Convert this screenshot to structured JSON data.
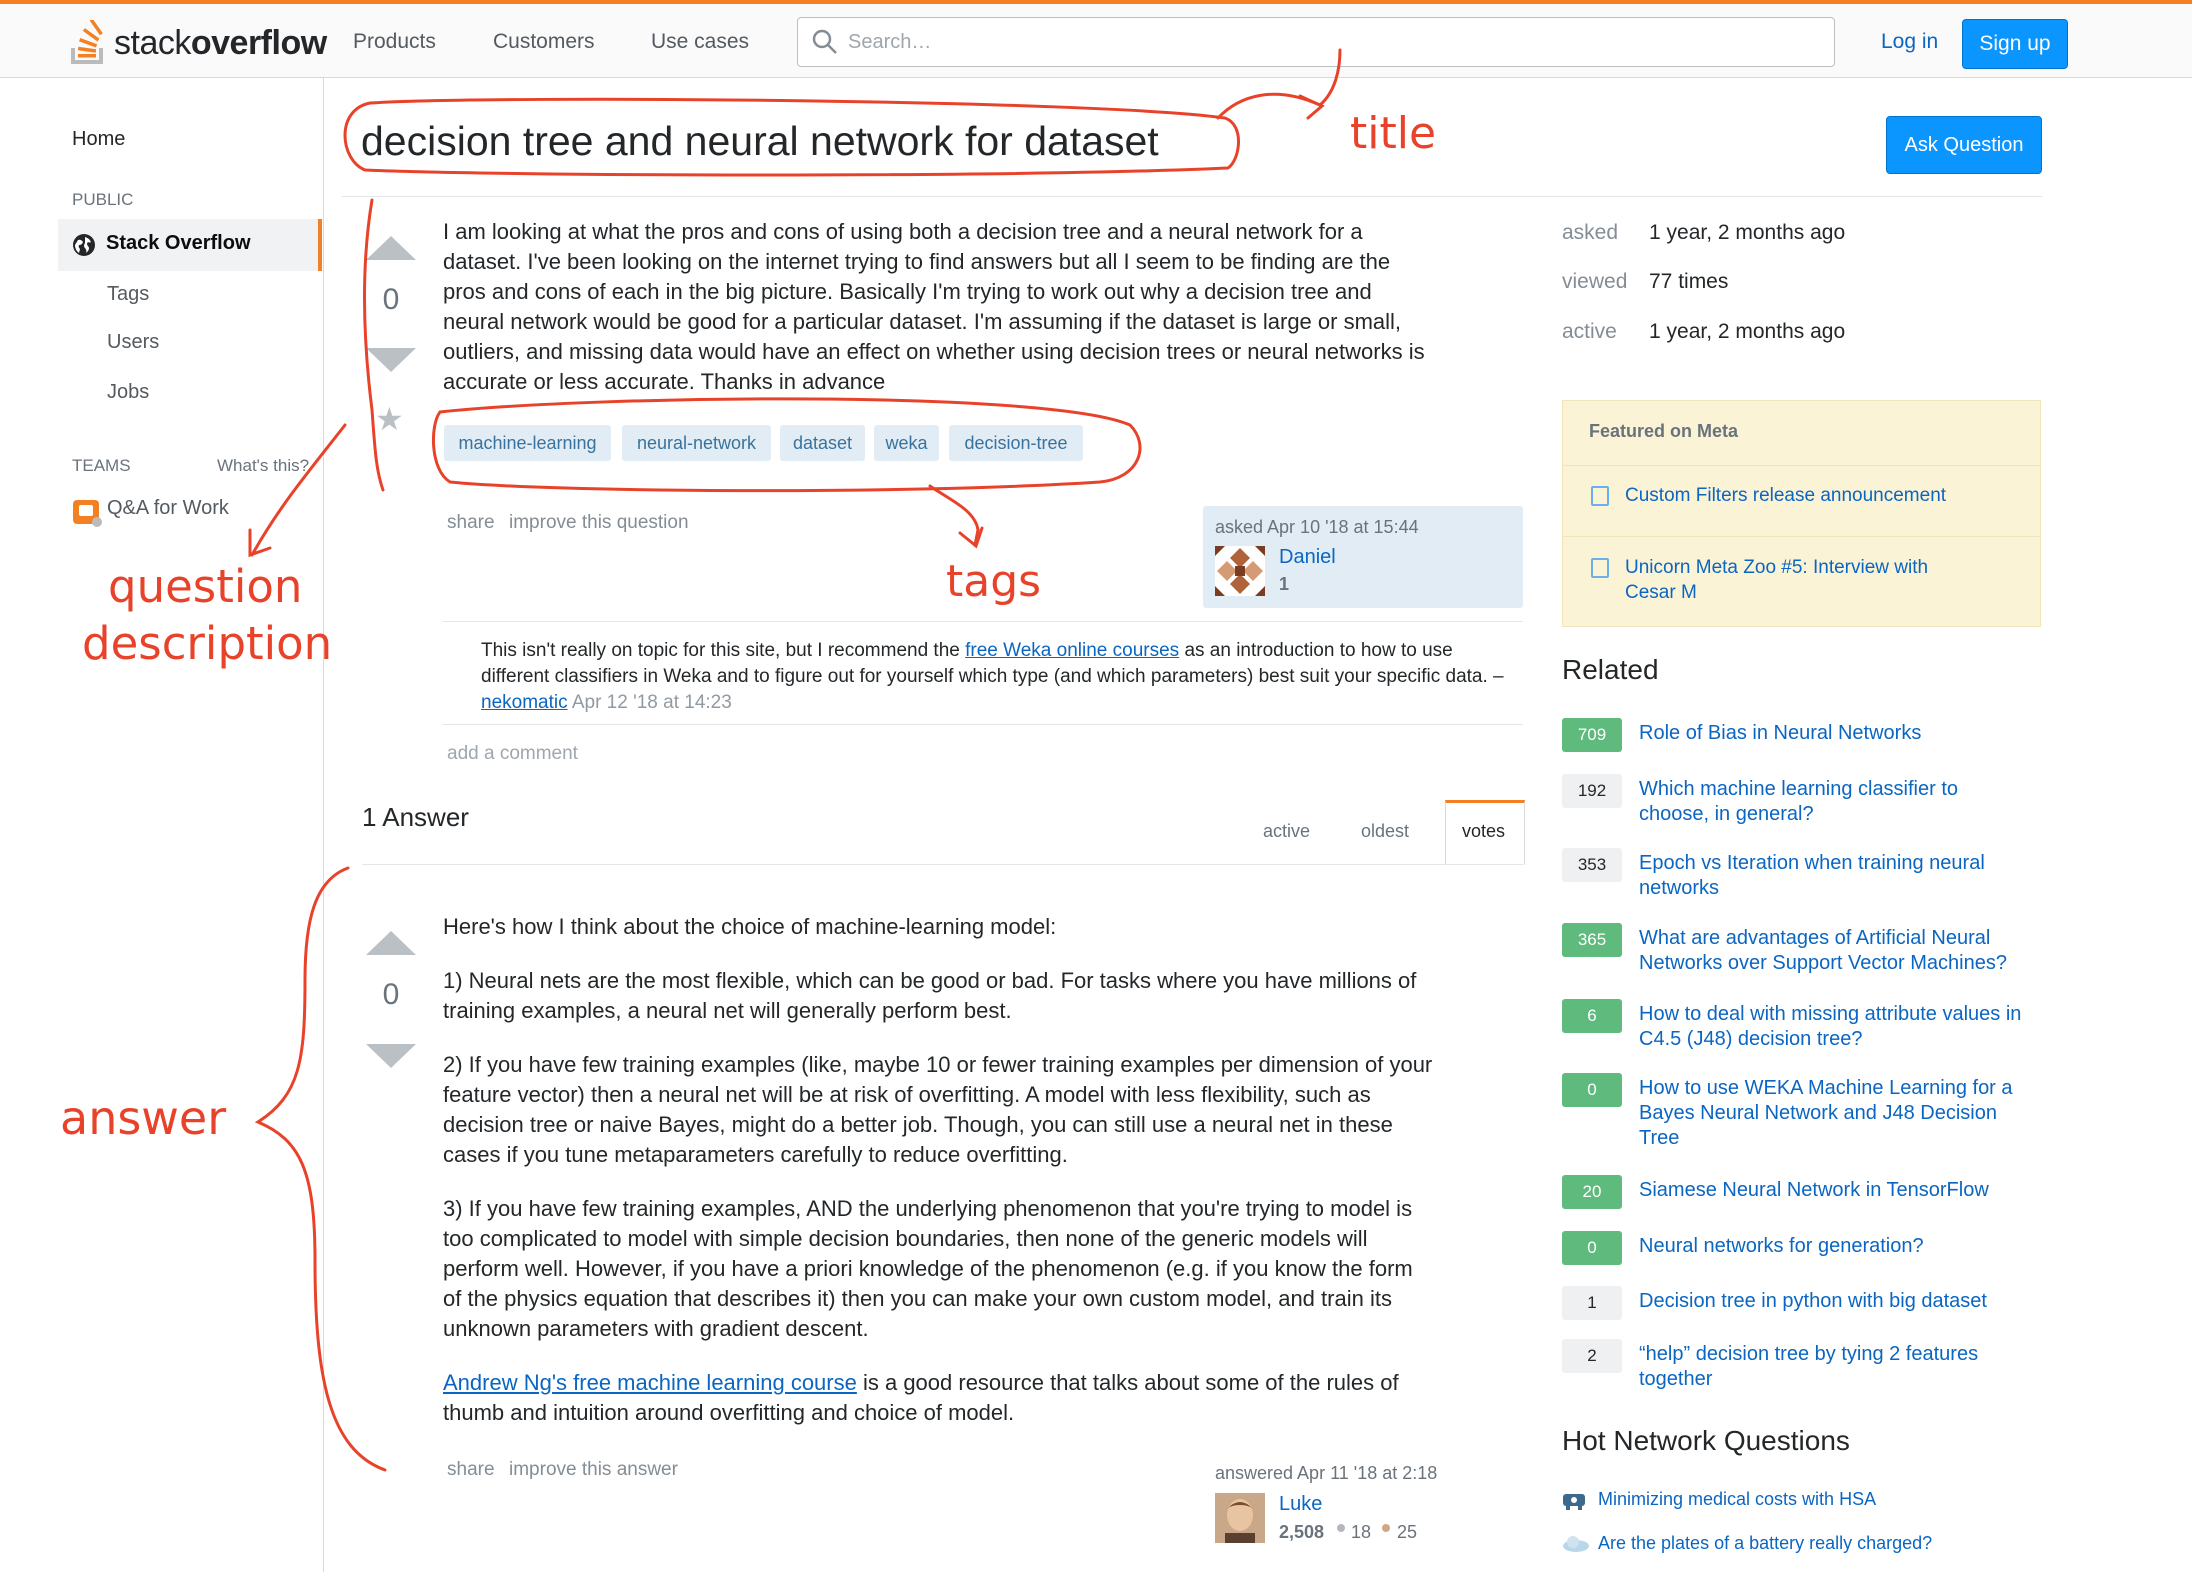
{
  "header": {
    "logo_text_light": "stack",
    "logo_text_bold": "overflow",
    "nav": [
      "Products",
      "Customers",
      "Use cases"
    ],
    "search_placeholder": "Search…",
    "login": "Log in",
    "signup": "Sign up"
  },
  "sidebar": {
    "home": "Home",
    "public": "PUBLIC",
    "stack_overflow": "Stack Overflow",
    "tags": "Tags",
    "users": "Users",
    "jobs": "Jobs",
    "teams": "TEAMS",
    "whats_this": "What's this?",
    "qa_for_work": "Q&A for Work"
  },
  "question": {
    "title": "decision tree and neural network for dataset",
    "ask_button": "Ask Question",
    "votes": "0",
    "body_lines": [
      "I am looking at what the pros and cons of using both a decision tree and a neural network for a",
      "dataset. I've been looking on the internet trying to find answers but all I seem to be finding are the",
      "pros and cons of each in the big picture. Basically I'm trying to work out why a decision tree and",
      "neural network would be good for a particular dataset. I'm assuming if the dataset is large or small,",
      "outliers, and missing data would have an effect on whether using decision trees or neural networks is",
      "accurate or less accurate. Thanks in advance"
    ],
    "tags": [
      "machine-learning",
      "neural-network",
      "dataset",
      "weka",
      "decision-tree"
    ],
    "share": "share",
    "improve": "improve this question",
    "asked_time": "asked Apr 10 '18 at 15:44",
    "user_name": "Daniel",
    "user_rep": "1"
  },
  "comment": {
    "text_before": "This isn't really on topic for this site, but I recommend the ",
    "link": "free Weka online courses",
    "text_after": " as an introduction to how to use different classifiers in Weka and to figure out for yourself which type (and which parameters) best suit your specific data. – ",
    "author": "nekomatic",
    "time": " Apr 12 '18 at 14:23",
    "add_comment": "add a comment"
  },
  "answers": {
    "count_label": "1 Answer",
    "tabs": [
      "active",
      "oldest",
      "votes"
    ],
    "votes": "0",
    "intro": "Here's how I think about the choice of machine-learning model:",
    "p1": [
      "1) Neural nets are the most flexible, which can be good or bad. For tasks where you have millions of",
      "training examples, a neural net will generally perform best."
    ],
    "p2": [
      "2) If you have few training examples (like, maybe 10 or fewer training examples per dimension of your",
      "feature vector) then a neural net will be at risk of overfitting. A model with less flexibility, such as",
      "decision tree or naive Bayes, might do a better job. Though, you can still use a neural net in these",
      "cases if you tune metaparameters carefully to reduce overfitting."
    ],
    "p3": [
      "3) If you have few training examples, AND the underlying phenomenon that you're trying to model is",
      "too complicated to model with simple decision boundaries, then none of the generic models will",
      "perform well. However, if you have a priori knowledge of the phenomenon (e.g. if you know the form",
      "of the physics equation that describes it) then you can make your own custom model, and train its",
      "unknown parameters with gradient descent."
    ],
    "p4_link": "Andrew Ng's free machine learning course",
    "p4_rest_1": " is a good resource that talks about some of the rules of",
    "p4_rest_2": "thumb and intuition around overfitting and choice of model.",
    "share": "share",
    "improve": "improve this answer",
    "answered_time": "answered Apr 11 '18 at 2:18",
    "user_name": "Luke",
    "user_rep": "2,508",
    "silver": "18",
    "bronze": "25"
  },
  "stats": {
    "asked_label": "asked",
    "asked_value": "1 year, 2 months ago",
    "viewed_label": "viewed",
    "viewed_value": "77 times",
    "active_label": "active",
    "active_value": "1 year, 2 months ago"
  },
  "meta": {
    "heading": "Featured on Meta",
    "link1": "Custom Filters release announcement",
    "link2a": "Unicorn Meta Zoo #5: Interview with",
    "link2b": "Cesar M"
  },
  "related": {
    "heading": "Related",
    "items": [
      {
        "score": "709",
        "positive": true,
        "lines": [
          "Role of Bias in Neural Networks"
        ]
      },
      {
        "score": "192",
        "positive": false,
        "lines": [
          "Which machine learning classifier to",
          "choose, in general?"
        ]
      },
      {
        "score": "353",
        "positive": false,
        "lines": [
          "Epoch vs Iteration when training neural",
          "networks"
        ]
      },
      {
        "score": "365",
        "positive": true,
        "lines": [
          "What are advantages of Artificial Neural",
          "Networks over Support Vector Machines?"
        ]
      },
      {
        "score": "6",
        "positive": true,
        "lines": [
          "How to deal with missing attribute values in",
          "C4.5 (J48) decision tree?"
        ]
      },
      {
        "score": "0",
        "positive": true,
        "lines": [
          "How to use WEKA Machine Learning for a",
          "Bayes Neural Network and J48 Decision",
          "Tree"
        ]
      },
      {
        "score": "20",
        "positive": true,
        "lines": [
          "Siamese Neural Network in TensorFlow"
        ]
      },
      {
        "score": "0",
        "positive": true,
        "lines": [
          "Neural networks for generation?"
        ]
      },
      {
        "score": "1",
        "positive": false,
        "lines": [
          "Decision tree in python with big dataset"
        ]
      },
      {
        "score": "2",
        "positive": false,
        "lines": [
          "“help” decision tree by tying 2 features",
          "together"
        ]
      }
    ]
  },
  "hot": {
    "heading": "Hot Network Questions",
    "items": [
      "Minimizing medical costs with HSA",
      "Are the plates of a battery really charged?"
    ]
  },
  "annotations": {
    "title": "title",
    "tags": "tags",
    "question_1": "question",
    "question_2": "description",
    "answer": "answer"
  },
  "colors": {
    "accent": "#f48024",
    "link": "#0a66c2",
    "button": "#0a95ff",
    "annotation": "#e8432a",
    "positive_score": "#5eba7d"
  }
}
